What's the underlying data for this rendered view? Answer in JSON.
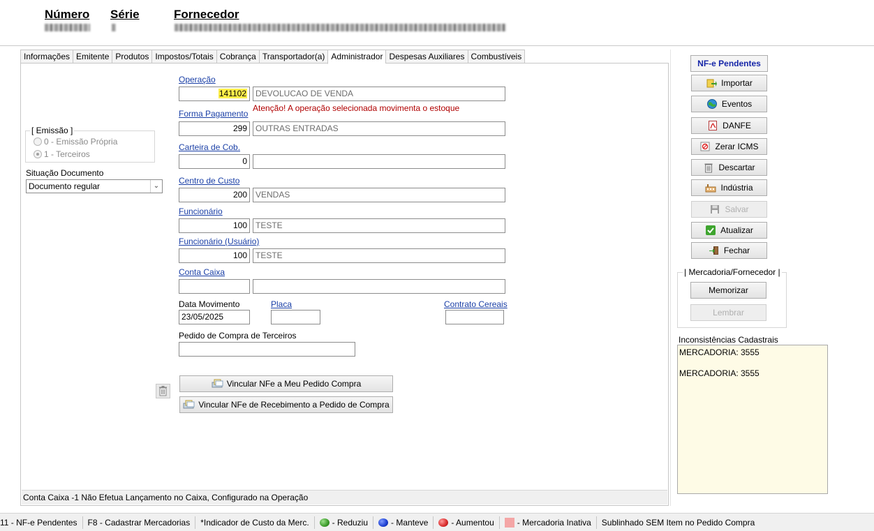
{
  "header": {
    "numero_label": "Número",
    "serie_label": "Série",
    "fornecedor_label": "Fornecedor"
  },
  "tabs": [
    "Informações",
    "Emitente",
    "Produtos",
    "Impostos/Totais",
    "Cobrança",
    "Transportador(a)",
    "Administrador",
    "Despesas Auxiliares",
    "Combustíveis"
  ],
  "active_tab": "Administrador",
  "emissao": {
    "title": "[ Emissão ]",
    "opt0": "0 - Emissão Própria",
    "opt1": "1 - Terceiros",
    "selected": "1 - Terceiros"
  },
  "situacao": {
    "label": "Situação Documento",
    "value": "Documento regular"
  },
  "form": {
    "operacao": {
      "label": "Operação",
      "code": "141102",
      "desc": "DEVOLUCAO DE VENDA",
      "warning": "Atenção! A operação selecionada movimenta o estoque"
    },
    "forma_pagamento": {
      "label": "Forma Pagamento",
      "code": "299",
      "desc": "OUTRAS ENTRADAS"
    },
    "carteira": {
      "label": "Carteira de Cob.",
      "code": "0",
      "desc": ""
    },
    "centro_custo": {
      "label": "Centro de Custo",
      "code": "200",
      "desc": "VENDAS"
    },
    "funcionario": {
      "label": "Funcionário",
      "code": "100",
      "desc": "TESTE"
    },
    "funcionario_usuario": {
      "label": "Funcionário (Usuário)",
      "code": "100",
      "desc": "TESTE"
    },
    "conta_caixa": {
      "label": "Conta Caixa",
      "code": "",
      "desc": ""
    },
    "data_movimento": {
      "label": "Data Movimento",
      "value": "23/05/2025"
    },
    "placa": {
      "label": "Placa",
      "value": ""
    },
    "contrato": {
      "label": "Contrato Cereais",
      "value": ""
    },
    "pedido_terceiros": {
      "label": "Pedido de Compra de Terceiros",
      "value": ""
    }
  },
  "buttons": {
    "vincular_pedido": "Vincular NFe a Meu Pedido Compra",
    "vincular_recebimento": "Vincular NFe de Recebimento a Pedido de Compra"
  },
  "panel_status": "Conta Caixa -1 Não Efetua Lançamento no Caixa, Configurado na Operação",
  "side": {
    "title": "NF-e Pendentes",
    "importar": "Importar",
    "eventos": "Eventos",
    "danfe": "DANFE",
    "zerar_icms": "Zerar ICMS",
    "descartar": "Descartar",
    "industria": "Indústria",
    "salvar": "Salvar",
    "atualizar": "Atualizar",
    "fechar": "Fechar",
    "merc_group": "| Mercadoria/Fornecedor |",
    "memorizar": "Memorizar",
    "lembrar": "Lembrar",
    "inconsistencias_label": "Inconsistências Cadastrais",
    "inconsistencias": [
      "MERCADORIA: 3555",
      "",
      "MERCADORIA: 3555"
    ]
  },
  "statusbar": {
    "f11": "11 - NF-e Pendentes",
    "f8": "F8 - Cadastrar Mercadorias",
    "indicador": "*Indicador de Custo da Merc.",
    "reduziu": "- Reduziu",
    "manteve": "- Manteve",
    "aumentou": "- Aumentou",
    "inativa": "- Mercadoria Inativa",
    "sublinhado": "Sublinhado SEM Item no Pedido Compra"
  },
  "colors": {
    "reduziu": "#4caf3a",
    "manteve": "#1c3fd1",
    "aumentou": "#d92b2b",
    "inativa": "#f4a6a6",
    "link": "#1a3fa6",
    "warning": "#b00000",
    "highlight": "#ffef4a"
  }
}
